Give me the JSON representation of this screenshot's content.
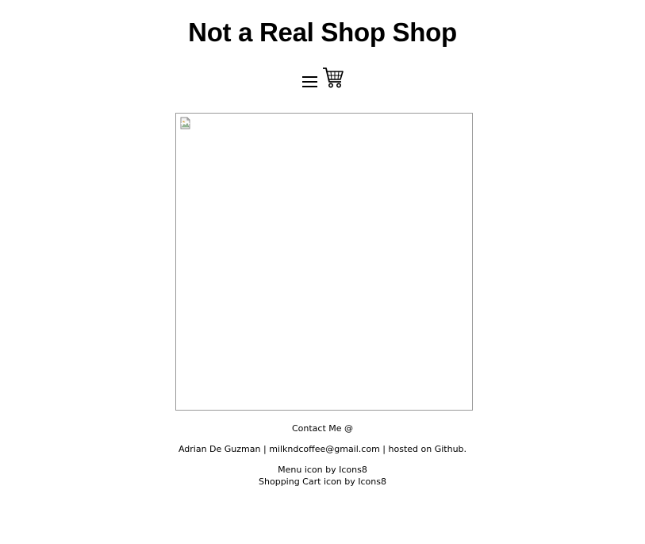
{
  "header": {
    "title": "Not a Real Shop Shop",
    "menu_icon": "hamburger-menu-icon",
    "cart_icon": "shopping-cart-icon"
  },
  "product": {
    "image_state": "broken-image-icon"
  },
  "footer": {
    "contact_heading": "Contact Me @",
    "author_name": "Adrian De Guzman",
    "separator": "|",
    "email": "milkndcoffee@gmail.com",
    "hosted_prefix": "hosted on ",
    "hosted_link": "Github",
    "hosted_suffix": ".",
    "credit_menu_prefix": "Menu icon by ",
    "credit_menu_link": "Icons8",
    "credit_cart_prefix": "Shopping Cart icon by ",
    "credit_cart_link": "Icons8"
  },
  "colors": {
    "background": "#ffffff",
    "text": "#000000",
    "frame_border": "#999999"
  }
}
